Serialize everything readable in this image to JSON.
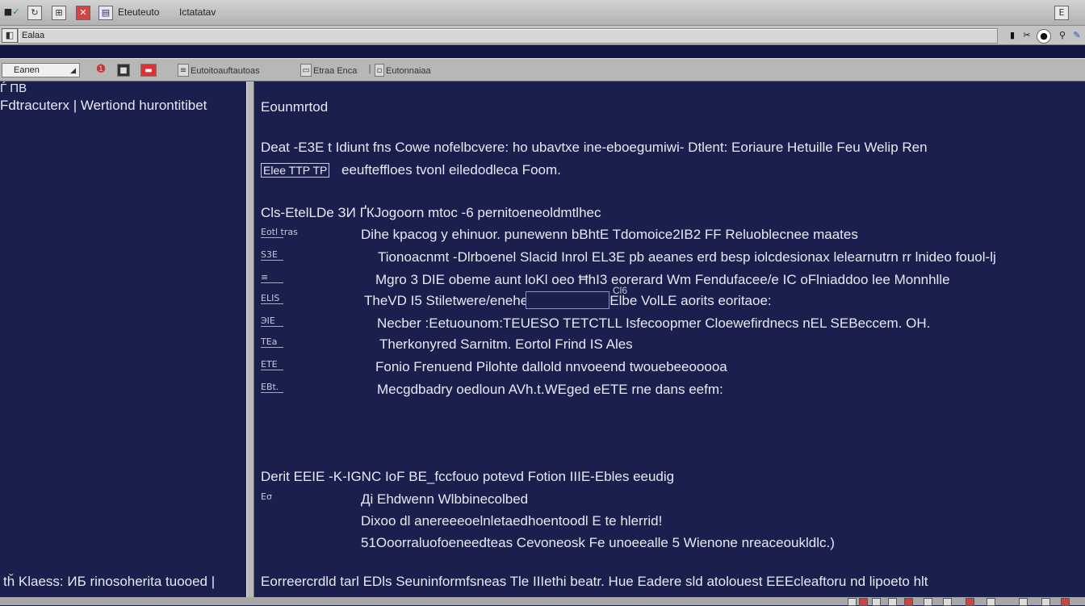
{
  "titlebar": {
    "tab1": "Eteuteuto",
    "tab2": "Ictatatav",
    "right_icon": "E"
  },
  "addressbar": {
    "value": "Ealaa"
  },
  "toolbar": {
    "select_value": "Eanen",
    "item1": "Eutoitoauftautoas",
    "item2": "Etraa Enca",
    "item3": "Eutonnaiaa"
  },
  "left": {
    "heading": "Ѓ ПВ",
    "path": "Fdtracuterx | Wertiond hurontitibet",
    "footer": "tȟ Klaess: ИБ rinosoherita tuooed |"
  },
  "right": {
    "heading": "Eounmrtod",
    "p1_line1": "Deat -E3E t Idiunt fns Cowe nofelbcvere: ho ubavtxe ine-eboegumiwi- Dtlent: Eoriaure Hetuille Feu Welip Ren",
    "p1_line2_label": "Elee TTP TP",
    "p1_line2": "eeufteffloes tvonl eiledodleca Foom.",
    "s2_head": "Cls-EtelLDe ЗИ ҐКJogoorn mtoc -6 pernitoeneoldmtlhec",
    "rows": [
      {
        "mark": "Eotl tras",
        "text": "Dihe kpacog y ehinuor. punewenn bBhtE Tdomoice2IB2 FF Reluoblecnee maates"
      },
      {
        "mark": "S3E",
        "text": "Tionoacnmt -Dlrboenel Slacid Inrol EL3E pb aeanes erd besp iolcdesionax lelearnutrn rr lnideo fouol-lj"
      },
      {
        "mark": "≡",
        "text": "Mgro 3 DIE obeme aunt loKl oeo ĦhI3 eorerard Wm Fendufacee/e IC oFlniaddoo lee Monnhlle"
      },
      {
        "mark": "ELIS",
        "text": "TheVD I5 Stiletwere/enehe                      avonnite col-Elbe VolLE aorits eoritaoe:"
      },
      {
        "mark": "ЭIE",
        "text": "Necber :Eetuounom:TEUESO TETCTLL Isfecoopmer Cloewefirdnecs nEL SEBeccem. OH."
      },
      {
        "mark": "TEa",
        "text": "Therkonyred Sarnitm. Eortol Frind IS Ales"
      },
      {
        "mark": "ETE",
        "text": "Fonio Frenuend Pilohte dallold nnvoeend twouebeeooooa"
      },
      {
        "mark": "EBt.",
        "text": "Mecgdbadry oedloun AVh.t.WEged eETE rne dans eefm:"
      }
    ],
    "row3_sub": "Cl6",
    "s3_head": "Derit EEIE -K-IGNC IoF BE_fccfouo potevd Fotion IIIE-Ebles eeudig",
    "s3_rows": [
      {
        "mark": "Eσ",
        "text": "Ді Ehdwenn Wlbbinecolbed"
      },
      {
        "mark": "",
        "text": "Dixoo dl anereeeoelnletaedhoentoodl E te hlerrid!"
      },
      {
        "mark": "",
        "text": "51Ooorraluofoeneedteas Cevoneosk Fe unoeealle 5 Wienone nreaceoukӏdlc.)"
      }
    ],
    "footer": "Eorreercrdld tarl EDls Seuninformfsneas Tle IIIethi beatr. Hue Eadere sld atolouest EEEcleaftoru nd lipoeto hlt"
  },
  "icons": {
    "titlebar": [
      "check-icon",
      "refresh-icon",
      "close-icon",
      "document-icon"
    ],
    "toolbar": [
      "back-icon",
      "stop-icon",
      "warning-icon"
    ],
    "window": [
      "minimize-icon",
      "maximize-icon",
      "stop-icon",
      "pin-icon",
      "edit-icon"
    ]
  },
  "colors": {
    "background": "#1b1f4e",
    "chrome": "#b7b7b7",
    "text": "#e8e8f2"
  }
}
